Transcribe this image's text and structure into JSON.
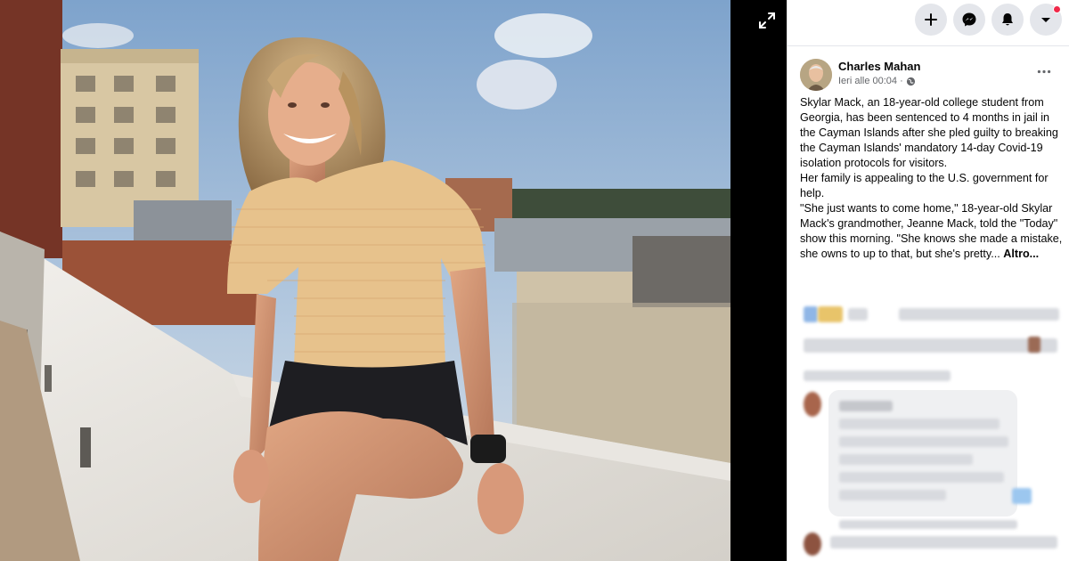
{
  "post": {
    "author": "Charles Mahan",
    "timestamp": "Ieri alle 00:04 ·",
    "paragraphs": [
      "Skylar Mack, an 18-year-old college student from Georgia, has been sentenced to 4 months in jail in the Cayman Islands after she pled guilty to breaking the Cayman Islands' mandatory 14-day Covid-19 isolation protocols for visitors.",
      "Her family is appealing to the U.S. government for help.",
      "\"She just wants to come home,\" 18-year-old Skylar Mack's grandmother, Jeanne Mack, told the \"Today\" show this morning. \"She knows she made a mistake, she owns to up to that, but she's pretty..."
    ],
    "more_label": "Altro..."
  },
  "icons": {
    "expand": "expand-icon",
    "create": "plus-icon",
    "messenger": "messenger-icon",
    "notifications": "bell-icon",
    "account": "caret-down-icon",
    "privacy": "globe-icon",
    "options": "more-icon"
  },
  "colors": {
    "panel_bg": "#ffffff",
    "button_bg": "#e4e6eb",
    "notification_dot": "#f02849",
    "secondary_text": "#65676b"
  }
}
